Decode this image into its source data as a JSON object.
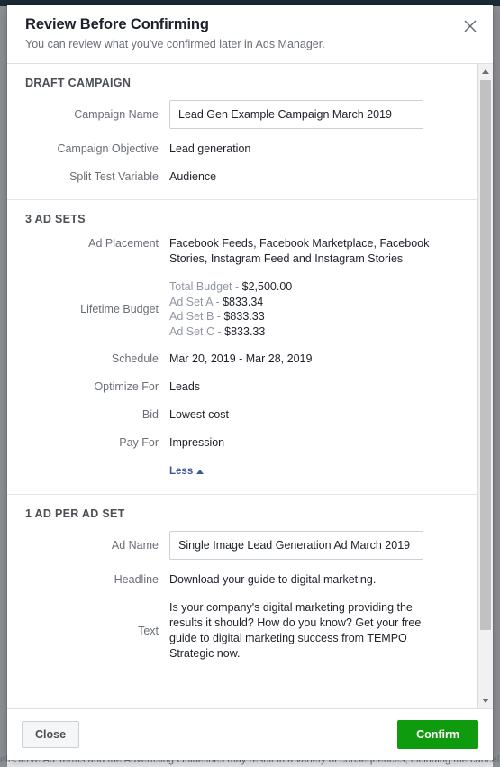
{
  "background": {
    "legal_text": "elf-Serve Ad Terms and the Advertising Guidelines may result in a variety of consequences, including the cancellat"
  },
  "modal": {
    "title": "Review Before Confirming",
    "subtitle": "You can review what you've confirmed later in Ads Manager.",
    "close_icon": "close-icon",
    "sections": [
      {
        "title": "DRAFT CAMPAIGN",
        "fields": [
          {
            "label": "Campaign Name",
            "value": "Lead Gen Example Campaign March 2019",
            "type": "input"
          },
          {
            "label": "Campaign Objective",
            "value": "Lead generation",
            "type": "text"
          },
          {
            "label": "Split Test Variable",
            "value": "Audience",
            "type": "text"
          }
        ]
      },
      {
        "title": "3 AD SETS",
        "fields": [
          {
            "label": "Ad Placement",
            "value": "Facebook Feeds, Facebook Marketplace, Facebook Stories, Instagram Feed and Instagram Stories",
            "type": "text"
          },
          {
            "label": "Lifetime Budget",
            "type": "budget",
            "lines": [
              {
                "key": "Total Budget -",
                "amount": "$2,500.00"
              },
              {
                "key": "Ad Set A -",
                "amount": "$833.34"
              },
              {
                "key": "Ad Set B -",
                "amount": "$833.33"
              },
              {
                "key": "Ad Set C -",
                "amount": "$833.33"
              }
            ]
          },
          {
            "label": "Schedule",
            "value": "Mar 20, 2019 - Mar 28, 2019",
            "type": "text"
          },
          {
            "label": "Optimize For",
            "value": "Leads",
            "type": "text"
          },
          {
            "label": "Bid",
            "value": "Lowest cost",
            "type": "text"
          },
          {
            "label": "Pay For",
            "value": "Impression",
            "type": "text"
          }
        ],
        "toggle_link": {
          "label": "Less",
          "icon": "caret-up-icon"
        }
      },
      {
        "title": "1 AD PER AD SET",
        "fields": [
          {
            "label": "Ad Name",
            "value": "Single Image Lead Generation Ad March 2019",
            "type": "input"
          },
          {
            "label": "Headline",
            "value": "Download your guide to digital marketing.",
            "type": "text"
          },
          {
            "label": "Text",
            "value": "Is your company's digital marketing providing the results it should? How do you know? Get your free guide to digital marketing success from TEMPO Strategic now.",
            "type": "text"
          }
        ]
      }
    ],
    "footer": {
      "close_label": "Close",
      "confirm_label": "Confirm"
    },
    "scrollbar": {
      "up_arrow": "scroll-up-arrow-icon",
      "down_arrow": "scroll-down-arrow-icon"
    }
  },
  "colors": {
    "confirm_green": "#0e9b0e",
    "link_blue": "#3b5998",
    "label_gray": "#6a6f76",
    "muted_gray": "#9197a3"
  }
}
